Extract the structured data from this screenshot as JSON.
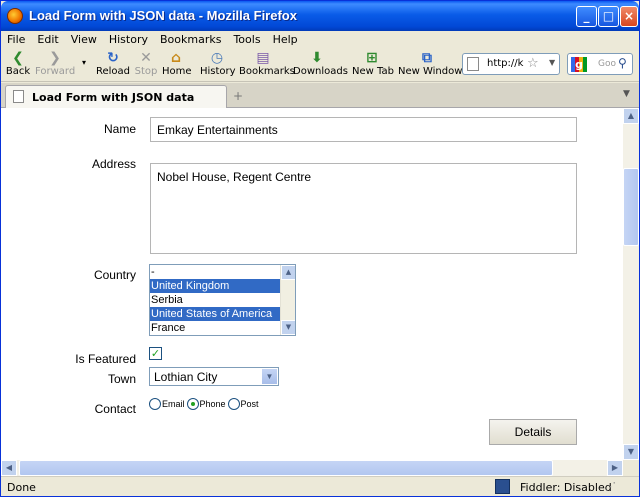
{
  "window": {
    "title": "Load Form with JSON data - Mozilla Firefox",
    "controls": {
      "minimize": "_",
      "maximize": "□",
      "close": "×"
    }
  },
  "menu": [
    "File",
    "Edit",
    "View",
    "History",
    "Bookmarks",
    "Tools",
    "Help"
  ],
  "toolbar": {
    "back": "Back",
    "forward": "Forward",
    "reload": "Reload",
    "stop": "Stop",
    "home": "Home",
    "history": "History",
    "bookmarks": "Bookmarks",
    "downloads": "Downloads",
    "new_tab": "New Tab",
    "new_window": "New Window"
  },
  "address": {
    "url": "http://k"
  },
  "search": {
    "placeholder": "Goo"
  },
  "tabs": [
    {
      "label": "Load Form with JSON data"
    }
  ],
  "form": {
    "name_label": "Name",
    "name_value": "Emkay Entertainments",
    "address_label": "Address",
    "address_value": "Nobel House, Regent Centre",
    "country_label": "Country",
    "country_options": [
      {
        "label": "-",
        "selected": false
      },
      {
        "label": "United Kingdom",
        "selected": true
      },
      {
        "label": "Serbia",
        "selected": false
      },
      {
        "label": "United States of America",
        "selected": true
      },
      {
        "label": "France",
        "selected": false
      }
    ],
    "featured_label": "Is Featured",
    "featured_checked": true,
    "town_label": "Town",
    "town_value": "Lothian City",
    "contact_label": "Contact",
    "contact_options": [
      {
        "label": "Email",
        "selected": false
      },
      {
        "label": "Phone",
        "selected": true
      },
      {
        "label": "Post",
        "selected": false
      }
    ],
    "details_button": "Details"
  },
  "status": {
    "text": "Done",
    "fiddler": "Fiddler: Disabled"
  }
}
